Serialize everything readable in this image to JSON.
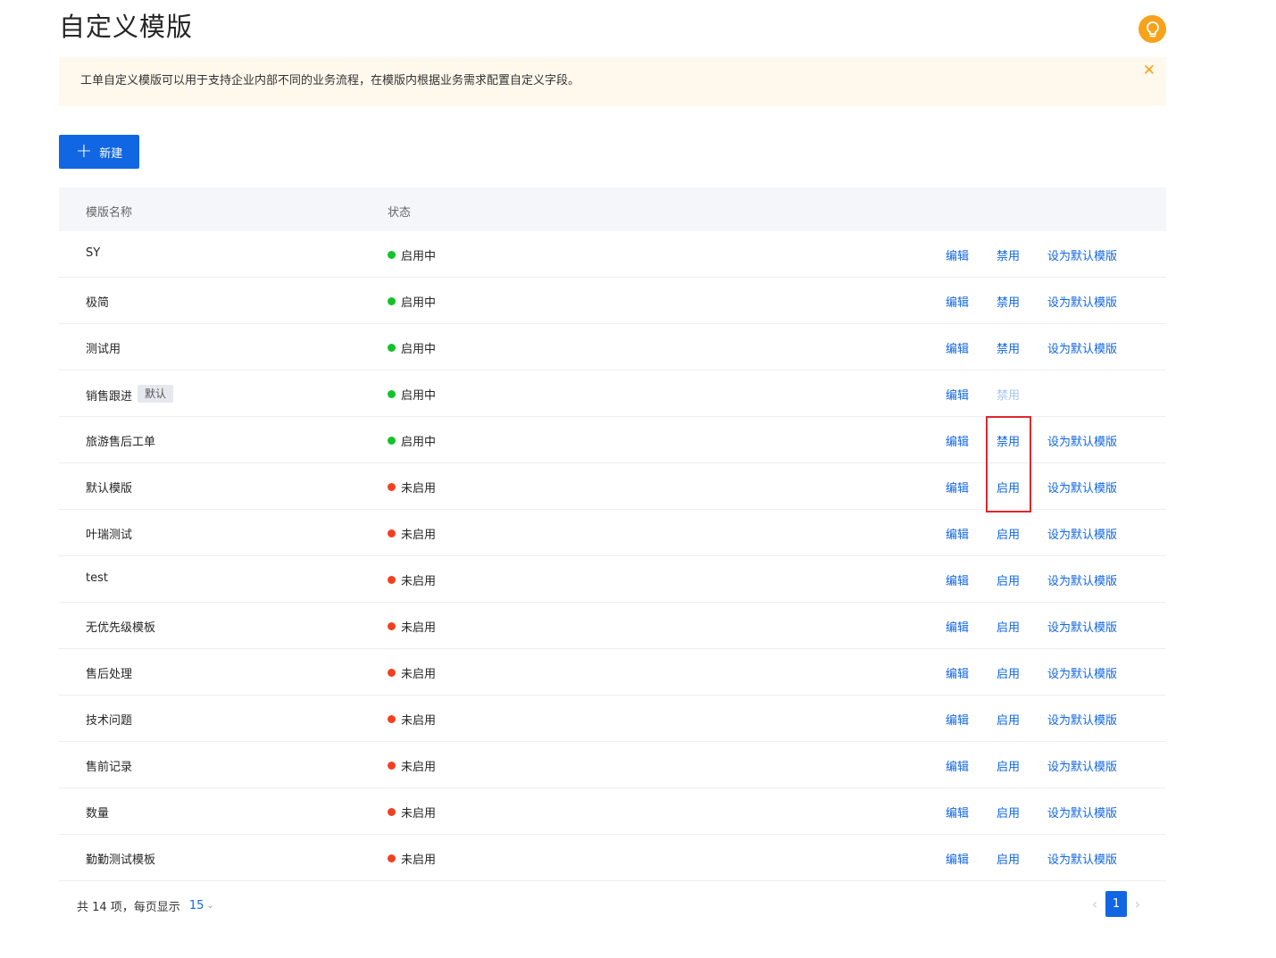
{
  "page": {
    "title": "自定义模版",
    "notice": "工单自定义模版可以用于支持企业内部不同的业务流程，在模版内根据业务需求配置自定义字段。",
    "new_button": "新建"
  },
  "table": {
    "headers": {
      "name": "模版名称",
      "status": "状态"
    },
    "rows": [
      {
        "name": "SY",
        "tag": "",
        "status": "启用中",
        "toggle": "禁用",
        "default": "设为默认模版"
      },
      {
        "name": "极简",
        "tag": "",
        "status": "启用中",
        "toggle": "禁用",
        "default": "设为默认模版"
      },
      {
        "name": "测试用",
        "tag": "",
        "status": "启用中",
        "toggle": "禁用",
        "default": "设为默认模版"
      },
      {
        "name": "销售跟进",
        "tag": "默认",
        "status": "启用中",
        "toggle": "禁用",
        "default": ""
      },
      {
        "name": "旅游售后工单",
        "tag": "",
        "status": "启用中",
        "toggle": "禁用",
        "default": "设为默认模版"
      },
      {
        "name": "默认模版",
        "tag": "",
        "status": "未启用",
        "toggle": "启用",
        "default": "设为默认模版"
      },
      {
        "name": "叶瑞测试",
        "tag": "",
        "status": "未启用",
        "toggle": "启用",
        "default": "设为默认模版"
      },
      {
        "name": "test",
        "tag": "",
        "status": "未启用",
        "toggle": "启用",
        "default": "设为默认模版"
      },
      {
        "name": "无优先级模板",
        "tag": "",
        "status": "未启用",
        "toggle": "启用",
        "default": "设为默认模版"
      },
      {
        "name": "售后处理",
        "tag": "",
        "status": "未启用",
        "toggle": "启用",
        "default": "设为默认模版"
      },
      {
        "name": "技术问题",
        "tag": "",
        "status": "未启用",
        "toggle": "启用",
        "default": "设为默认模版"
      },
      {
        "name": "售前记录",
        "tag": "",
        "status": "未启用",
        "toggle": "启用",
        "default": "设为默认模版"
      },
      {
        "name": "数量",
        "tag": "",
        "status": "未启用",
        "toggle": "启用",
        "default": "设为默认模版"
      },
      {
        "name": "勤勤测试模板",
        "tag": "",
        "status": "未启用",
        "toggle": "启用",
        "default": "设为默认模版"
      }
    ],
    "edit_label": "编辑"
  },
  "footer": {
    "total_text": "共 14 项，每页显示",
    "page_size": "15",
    "current_page": "1"
  },
  "colors": {
    "primary": "#1166e3",
    "enabled_dot": "#13c22a",
    "disabled_dot": "#f2401f",
    "highlight_box": "#e0272b"
  }
}
